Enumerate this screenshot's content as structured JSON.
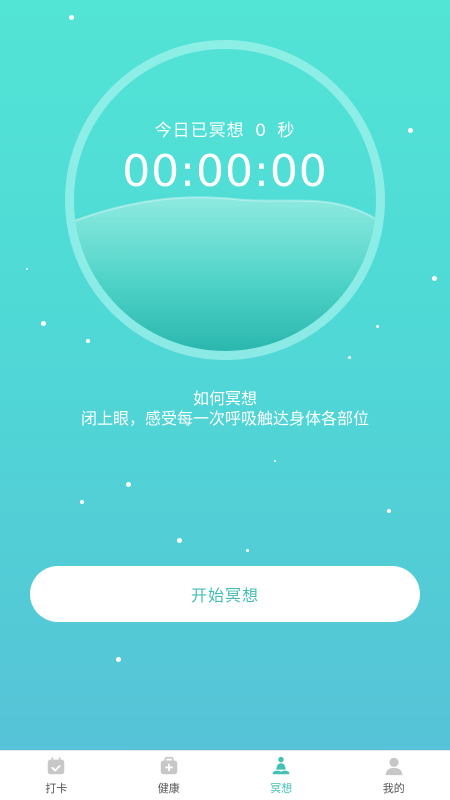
{
  "meditation": {
    "today_label": "今日已冥想",
    "today_value": "0",
    "today_unit": "秒",
    "timer": "00:00:00"
  },
  "howto": {
    "title": "如何冥想",
    "text": "闭上眼，感受每一次呼吸触达身体各部位"
  },
  "start_button": {
    "label": "开始冥想"
  },
  "tabbar": {
    "items": [
      {
        "label": "打卡",
        "icon": "calendar-check-icon",
        "active": false
      },
      {
        "label": "健康",
        "icon": "medical-kit-icon",
        "active": false
      },
      {
        "label": "冥想",
        "icon": "meditation-icon",
        "active": true
      },
      {
        "label": "我的",
        "icon": "user-icon",
        "active": false
      }
    ]
  },
  "colors": {
    "accent": "#43c1b6",
    "background_top": "#52e4d5",
    "background_bottom": "#58c0d8"
  }
}
